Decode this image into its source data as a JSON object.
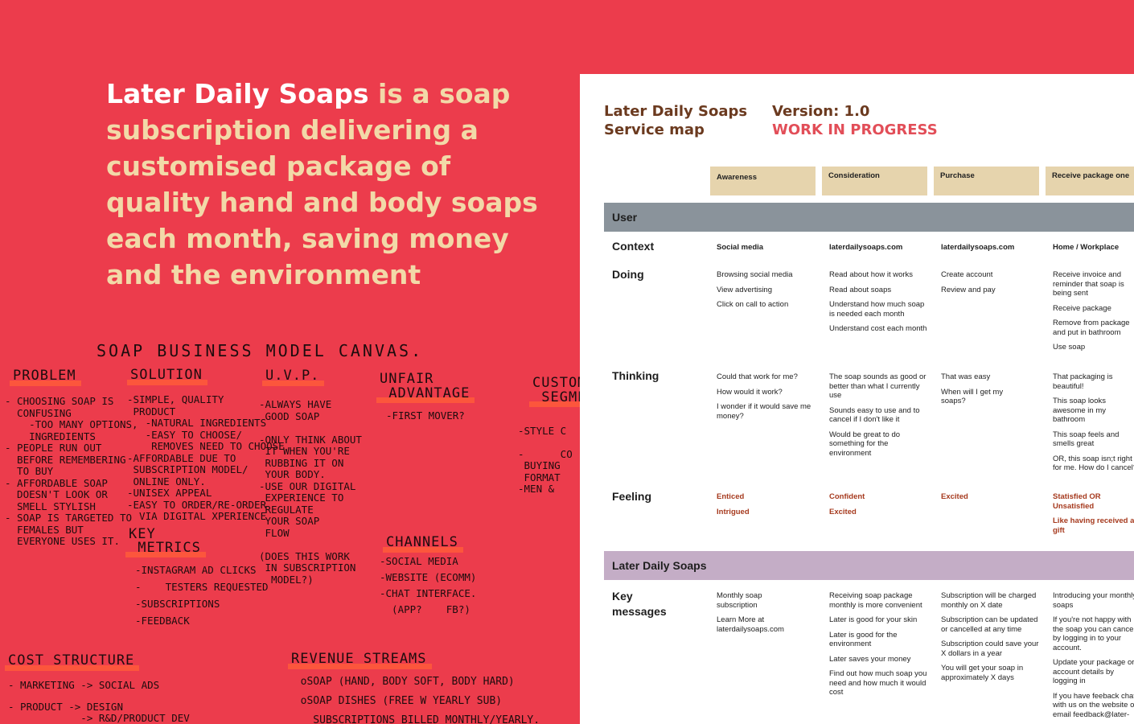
{
  "headline": {
    "brand": "Later Daily Soaps",
    "rest": " is a soap subscription delivering a customised package of quality hand and body soaps each month, saving money and the environment"
  },
  "colors": {
    "background": "#ec3c4c",
    "headline_text": "#f2d9a8",
    "headline_brand": "#ffffff",
    "stage_fill": "#e6d4ad",
    "user_band": "#8a939b",
    "company_band": "#c4adc6",
    "title_brown": "#6b3a1f",
    "wip_red": "#e24e58"
  },
  "canvas": {
    "title": "SOAP BUSINESS MODEL CANVAS.",
    "problem": {
      "heading": "PROBLEM",
      "notes": "- CHOOSING SOAP IS\n  CONFUSING\n    -TOO MANY OPTIONS,\n    INGREDIENTS\n- PEOPLE RUN OUT\n  BEFORE REMEMBERING\n  TO BUY\n- AFFORDABLE SOAP\n  DOESN'T LOOK OR\n  SMELL STYLISH\n- SOAP IS TARGETED TO\n  FEMALES BUT\n  EVERYONE USES IT."
    },
    "solution": {
      "heading": "SOLUTION",
      "notes": "-SIMPLE, QUALITY\n PRODUCT\n   -NATURAL INGREDIENTS\n   -EASY TO CHOOSE/\n    REMOVES NEED TO CHOOSE\n-AFFORDABLE DUE TO\n SUBSCRIPTION MODEL/\n ONLINE ONLY.\n-UNISEX APPEAL\n-EASY TO ORDER/RE-ORDER\n  VIA DIGITAL XPERIENCE"
    },
    "uvp": {
      "heading": "U.V.P.",
      "notes": "-ALWAYS HAVE\n GOOD SOAP\n\n-ONLY THINK ABOUT\n IT WHEN YOU'RE\n RUBBING IT ON\n YOUR BODY.\n-USE OUR DIGITAL\n EXPERIENCE TO\n REGULATE\n YOUR SOAP\n FLOW\n\n(DOES THIS WORK\n IN SUBSCRIPTION\n  MODEL?)"
    },
    "unfair_advantage": {
      "heading": "UNFAIR\n ADVANTAGE",
      "notes": "-FIRST MOVER?"
    },
    "customer_segments": {
      "heading": "CUSTOMER\n SEGMENTS",
      "notes": "\n-STYLE C\n\n-      CO\n BUYING\n FORMAT\n-MEN &"
    },
    "key_metrics": {
      "heading": "KEY\n METRICS",
      "notes": "-INSTAGRAM AD CLICKS\n-    TESTERS REQUESTED\n-SUBSCRIPTIONS\n-FEEDBACK"
    },
    "channels": {
      "heading": "CHANNELS",
      "notes": "-SOCIAL MEDIA\n-WEBSITE (ECOMM)\n-CHAT INTERFACE.\n  (APP?    FB?)"
    },
    "cost_structure": {
      "heading": "COST STRUCTURE",
      "notes": "- MARKETING -> SOCIAL ADS\n\n- PRODUCT -> DESIGN\n            -> R&D/PRODUCT DEV"
    },
    "revenue_streams": {
      "heading": "REVENUE STREAMS",
      "notes": "  oSOAP (HAND, BODY SOFT, BODY HARD)\n  oSOAP DISHES (FREE W YEARLY SUB)\n    SUBSCRIPTIONS BILLED MONTHLY/YEARLY."
    }
  },
  "service_map": {
    "title_line1": "Later Daily Soaps",
    "title_line2": "Service map",
    "version": "Version: 1.0",
    "status": "WORK IN PROGRESS",
    "stages": [
      "Awareness",
      "Consideration",
      "Purchase",
      "Receive package one"
    ],
    "user_band": "User",
    "company_band": "Later Daily Soaps",
    "row_labels": {
      "context": "Context",
      "doing": "Doing",
      "thinking": "Thinking",
      "feeling": "Feeling",
      "key_messages": "Key messages"
    },
    "context": [
      "Social media",
      "laterdailysoaps.com",
      "laterdailysoaps.com",
      "Home / Workplace"
    ],
    "doing": [
      [
        "Browsing social media",
        "View advertising",
        "Click on call to action"
      ],
      [
        "Read about how it works",
        "Read about soaps",
        "Understand how much soap is needed each month",
        "Understand cost each month"
      ],
      [
        "Create account",
        "Review and pay"
      ],
      [
        "Receive invoice and reminder that soap is being sent",
        "Receive package",
        "Remove from package and put in bathroom",
        "Use soap"
      ]
    ],
    "thinking": [
      [
        "Could that work for me?",
        "How would it work?",
        "I wonder if it would save me money?"
      ],
      [
        "The soap sounds as good or better than what I currently use",
        "Sounds easy to use and to cancel if I don't like it",
        "Would be great to do something for the environment"
      ],
      [
        "That was easy",
        "When will I get my soaps?"
      ],
      [
        "That packaging is beautiful!",
        "This soap looks awesome in my bathroom",
        "This soap feels and smells great",
        "OR, this soap isn;t right for me. How do I cancel?"
      ]
    ],
    "feeling": [
      [
        "Enticed",
        "Intrigued"
      ],
      [
        "Confident",
        "Excited"
      ],
      [
        "Excited"
      ],
      [
        "Statisfied OR Unsatisfied",
        "Like having received a gift"
      ]
    ],
    "key_messages": [
      [
        "Monthly soap subscription",
        "Learn More at laterdailysoaps.com"
      ],
      [
        "Receiving soap package monthly is more convenient",
        "Later is good for your skin",
        "Later is good for the environment",
        "Later saves your money",
        "Find out how much soap you need and how much it would cost"
      ],
      [
        "Subscription will be charged monthly on X date",
        "Subscription can be updated or cancelled at any time",
        "Subscription could save your X dollars in a year",
        "You will get your soap in approximately X days"
      ],
      [
        "Introducing your monthly soaps",
        "If you're not happy with the soap you can cancel by logging in to your account.",
        "Update your package or account details by logging in",
        "If you have feeback chat with us on the website or email feedback@later-"
      ]
    ]
  }
}
